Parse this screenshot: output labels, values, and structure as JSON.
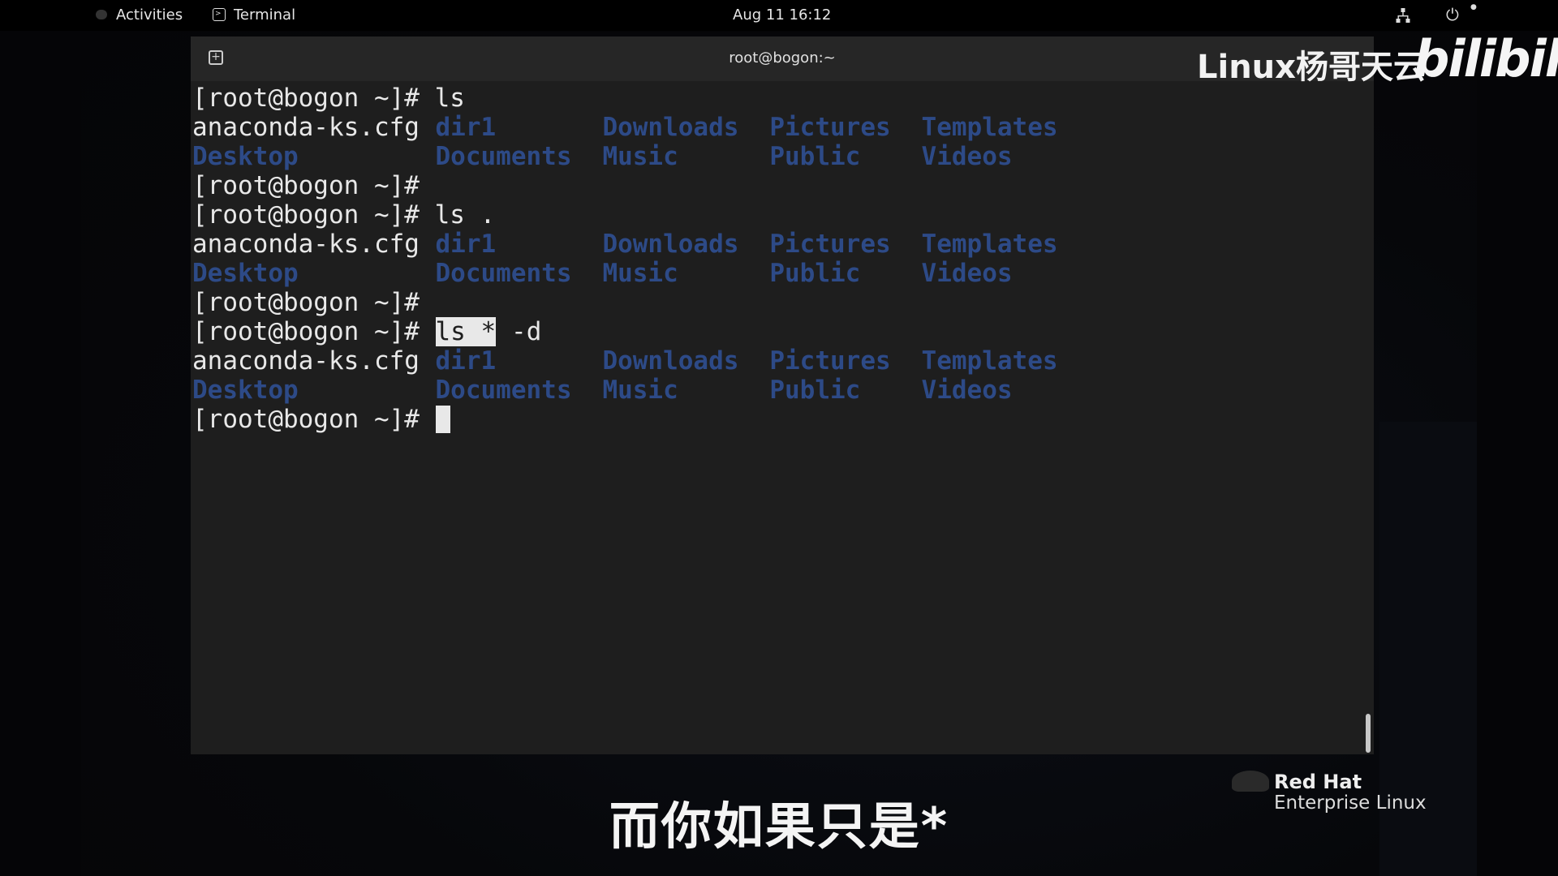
{
  "topbar": {
    "activities_label": "Activities",
    "app_name": "Terminal",
    "clock": "Aug 11  16:12",
    "icons": [
      "network-icon",
      "power-icon"
    ]
  },
  "window": {
    "title": "root@bogon:~",
    "new_tab_icon": "new-tab-icon"
  },
  "terminal": {
    "lines": [
      {
        "cells": [
          {
            "text": "[root@bogon ~]# ls",
            "col": 0,
            "kind": "text"
          }
        ]
      },
      {
        "cells": [
          {
            "text": "anaconda-ks.cfg",
            "col": 0,
            "kind": "text"
          },
          {
            "text": "dir1",
            "col": 16,
            "kind": "dir"
          },
          {
            "text": "Downloads",
            "col": 27,
            "kind": "dir"
          },
          {
            "text": "Pictures",
            "col": 38,
            "kind": "dir"
          },
          {
            "text": "Templates",
            "col": 48,
            "kind": "dir"
          }
        ]
      },
      {
        "cells": [
          {
            "text": "Desktop",
            "col": 0,
            "kind": "dir"
          },
          {
            "text": "Documents",
            "col": 16,
            "kind": "dir"
          },
          {
            "text": "Music",
            "col": 27,
            "kind": "dir"
          },
          {
            "text": "Public",
            "col": 38,
            "kind": "dir"
          },
          {
            "text": "Videos",
            "col": 48,
            "kind": "dir"
          }
        ]
      },
      {
        "cells": [
          {
            "text": "[root@bogon ~]#",
            "col": 0,
            "kind": "text"
          }
        ]
      },
      {
        "cells": [
          {
            "text": "[root@bogon ~]# ls .",
            "col": 0,
            "kind": "text"
          }
        ]
      },
      {
        "cells": [
          {
            "text": "anaconda-ks.cfg",
            "col": 0,
            "kind": "text"
          },
          {
            "text": "dir1",
            "col": 16,
            "kind": "dir"
          },
          {
            "text": "Downloads",
            "col": 27,
            "kind": "dir"
          },
          {
            "text": "Pictures",
            "col": 38,
            "kind": "dir"
          },
          {
            "text": "Templates",
            "col": 48,
            "kind": "dir"
          }
        ]
      },
      {
        "cells": [
          {
            "text": "Desktop",
            "col": 0,
            "kind": "dir"
          },
          {
            "text": "Documents",
            "col": 16,
            "kind": "dir"
          },
          {
            "text": "Music",
            "col": 27,
            "kind": "dir"
          },
          {
            "text": "Public",
            "col": 38,
            "kind": "dir"
          },
          {
            "text": "Videos",
            "col": 48,
            "kind": "dir"
          }
        ]
      },
      {
        "cells": [
          {
            "text": "[root@bogon ~]#",
            "col": 0,
            "kind": "text"
          }
        ]
      },
      {
        "cells": [
          {
            "text": "[root@bogon ~]# ",
            "col": 0,
            "kind": "text"
          },
          {
            "text": "ls *",
            "col": 16,
            "kind": "sel"
          },
          {
            "text": " -d",
            "col": 20,
            "kind": "text"
          }
        ]
      },
      {
        "cells": [
          {
            "text": "anaconda-ks.cfg",
            "col": 0,
            "kind": "text"
          },
          {
            "text": "dir1",
            "col": 16,
            "kind": "dir"
          },
          {
            "text": "Downloads",
            "col": 27,
            "kind": "dir"
          },
          {
            "text": "Pictures",
            "col": 38,
            "kind": "dir"
          },
          {
            "text": "Templates",
            "col": 48,
            "kind": "dir"
          }
        ]
      },
      {
        "cells": [
          {
            "text": "Desktop",
            "col": 0,
            "kind": "dir"
          },
          {
            "text": "Documents",
            "col": 16,
            "kind": "dir"
          },
          {
            "text": "Music",
            "col": 27,
            "kind": "dir"
          },
          {
            "text": "Public",
            "col": 38,
            "kind": "dir"
          },
          {
            "text": "Videos",
            "col": 48,
            "kind": "dir"
          }
        ]
      },
      {
        "cells": [
          {
            "text": "[root@bogon ~]# ",
            "col": 0,
            "kind": "text"
          },
          {
            "text": "",
            "col": 16,
            "kind": "cursor"
          }
        ]
      }
    ],
    "colors": {
      "directory": "#2d4a87",
      "foreground": "#e8e8e8",
      "background": "#1e1e1e"
    }
  },
  "watermark": {
    "channel": "Linux杨哥天云",
    "logo": "bilibili"
  },
  "brand": {
    "name": "Red Hat",
    "product": "Enterprise Linux"
  },
  "subtitle": "而你如果只是*"
}
